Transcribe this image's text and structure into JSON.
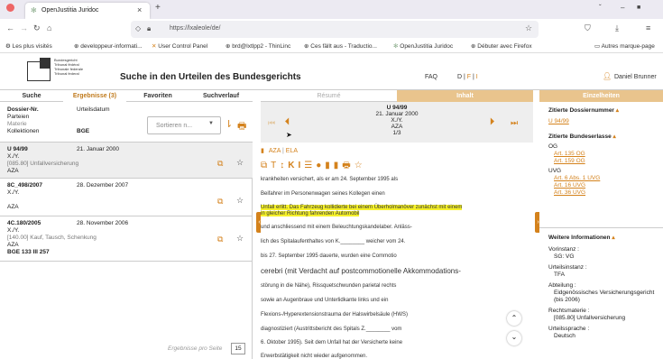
{
  "browser": {
    "tab_title": "OpenJustitia Juridoc",
    "tab_close": "×",
    "new_tab": "+",
    "url": "https://lxaleole/de/",
    "window_controls": [
      "ˇ",
      "–",
      "■"
    ]
  },
  "bookmarks": [
    "Les plus visités",
    "developpeur-informati...",
    "User Control Panel",
    "brd@lxtlpp2 - ThinLinc",
    "Ces fällt aus - Traductio...",
    "OpenJustitia Juridoc",
    "Débuter avec Firefox",
    "Autres marque-page"
  ],
  "app": {
    "logo_lines": [
      "Bundesgericht",
      "Tribunal fédéral",
      "Tribunale federale",
      "Tribunal federal"
    ],
    "title": "Suche in den Urteilen des Bundesgerichts",
    "faq": "FAQ",
    "lang_d": "D",
    "lang_f": "F",
    "lang_i": "I",
    "user": "Daniel Brunner"
  },
  "left_tabs": [
    "Suche",
    "Ergebnisse (3)",
    "Favoriten",
    "Suchverlauf"
  ],
  "mid_tabs": [
    "Résumé",
    "Inhalt"
  ],
  "right_tab": "Einzelheiten",
  "list_header": {
    "dossier_label": "Dossier-Nr.",
    "parteien": "Parteien",
    "materie": "Materie",
    "kollektionen": "Kollektionen",
    "urteilsdatum": "Urteilsdatum",
    "bge": "BGE",
    "sort_placeholder": "Sortieren n..."
  },
  "results": [
    {
      "nr": "U 94/99",
      "datum": "21. Januar 2000",
      "parteien": "X./Y.",
      "materie": "[085.80] Unfallversicherung",
      "koll": "AZA",
      "bge": ""
    },
    {
      "nr": "8C_498/2007",
      "datum": "28. Dezember 2007",
      "parteien": "X./Y.",
      "materie": "",
      "koll": "AZA",
      "bge": ""
    },
    {
      "nr": "4C.180/2005",
      "datum": "28. November 2006",
      "parteien": "X./Y.",
      "materie": "[140.00] Kauf, Tausch, Schenkung",
      "koll": "AZA",
      "bge": "BGE 133 III 257"
    }
  ],
  "per_page_label": "Ergebnisse pro Seite",
  "per_page_value": "15",
  "doc_nav": {
    "nr": "U 94/99",
    "datum": "21. Januar 2000",
    "parteien": "X./Y.",
    "koll": "AZA",
    "pos": "1/3"
  },
  "doc_lang": [
    "AZA",
    "ELA"
  ],
  "doc_lines": [
    "krankheiten versichert, als er am 24. September 1995 als",
    "Beifahrer im Personenwagen seines Kollegen einen",
    "Unfall erlitt. Das Fahrzeug kollidierte bei einem Überholmanöver zunächst mit einem",
    "in gleicher Richtung fahrenden Automobil",
    "und anschliessend mit einem Beleuchtungskandelaber. Anläss-",
    "lich des Spitalaufenthaltes von K.________ weicher vom 24.",
    "bis 27. September 1995 dauerte, wurden eine Commotio",
    "cerebri (mit Verdacht auf postcommotionelle Akkommodations-",
    "störung in die Nähe), Rissquetschwunden parietal rechts",
    "sowie an Augenbraue und Unterlidkante links und ein",
    "Flexions-/Hyperextensionstrauma der Halswirbelsäule (HWS)",
    "diagnostiziert (Austrittsbericht des Spitals Z.________ vom",
    "6. Oktober 1995). Seit dem Unfall hat der Versicherte keine",
    "Erwerbstätigkeit nicht wieder aufgenommen."
  ],
  "details": {
    "zitierte_dossiers_label": "Zitierte Dossiernummer",
    "zitierte_dossiers": [
      "U 94/99"
    ],
    "zitierte_erlasse_label": "Zitierte Bundeserlasse",
    "og_label": "OG",
    "og_items": [
      "Art. 135 OG",
      "Art. 159 OG"
    ],
    "uvg_label": "UVG",
    "uvg_items": [
      "Art. 6 Abs. 1 UVG",
      "Art. 16 UVG",
      "Art. 36 UVG"
    ],
    "weitere_label": "Weitere Informationen",
    "fields": [
      {
        "k": "Vorinstanz :",
        "v": "SG: VG"
      },
      {
        "k": "Urteilsinstanz :",
        "v": "TFA"
      },
      {
        "k": "Abteilung :",
        "v": "Eidgenössisches Versicherungsgericht (bis 2006)"
      },
      {
        "k": "Rechtsmaterie :",
        "v": "[085.80] Unfallversicherung"
      },
      {
        "k": "Urteilssprache :",
        "v": "Deutsch"
      }
    ]
  },
  "colors": {
    "accent": "#d4821c",
    "highlight": "#f6f12a"
  }
}
